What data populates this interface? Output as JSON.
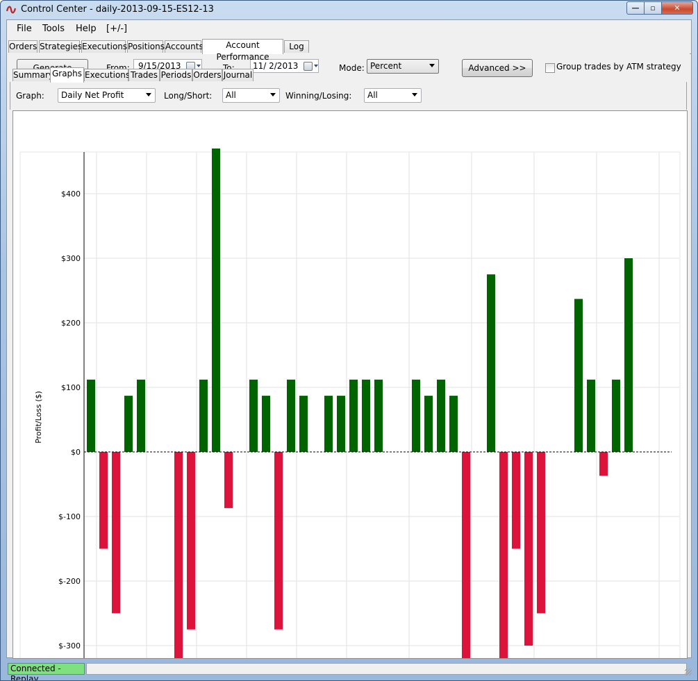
{
  "window": {
    "title": "Control Center - daily-2013-09-15-ES12-13",
    "min_glyph": "—",
    "max_glyph": "▫",
    "close_glyph": "✕"
  },
  "menu": {
    "file": "File",
    "tools": "Tools",
    "help": "Help",
    "toggle": "[+/-]"
  },
  "main_tabs": [
    "Orders",
    "Strategies",
    "Executions",
    "Positions",
    "Accounts",
    "Account Performance",
    "Log"
  ],
  "main_tab_active": "Account Performance",
  "toolbar": {
    "generate_label": "Generate",
    "from_label": "From:",
    "from_value": "9/15/2013",
    "to_label": "To:",
    "to_value": "11/ 2/2013",
    "mode_label": "Mode:",
    "mode_value": "Percent",
    "advanced_label": "Advanced >>",
    "group_label": "Group trades by ATM strategy",
    "group_checked": false
  },
  "sub_tabs": [
    "Summary",
    "Graphs",
    "Executions",
    "Trades",
    "Periods",
    "Orders",
    "Journal"
  ],
  "sub_tab_active": "Graphs",
  "filters": {
    "graph_label": "Graph:",
    "graph_value": "Daily Net Profit",
    "longshort_label": "Long/Short:",
    "longshort_value": "All",
    "winlose_label": "Winning/Losing:",
    "winlose_value": "All"
  },
  "chart_data": {
    "type": "bar",
    "ylabel": "Profit/Loss ($)",
    "xlabel": "",
    "title": "",
    "ylim": [
      -348,
      463
    ],
    "yticks": [
      400,
      300,
      200,
      100,
      0,
      -100,
      -200,
      -300
    ],
    "ytick_labels": [
      "$400",
      "$300",
      "$200",
      "$100",
      "$0",
      "$-100",
      "$-200",
      "$-300"
    ],
    "grid": true,
    "zero_line": "dashed",
    "colors": {
      "positive": "#006400",
      "negative": "#dc143c"
    },
    "values": [
      112,
      -150,
      -250,
      87,
      112,
      null,
      null,
      -350,
      -275,
      112,
      470,
      -87,
      null,
      112,
      87,
      -275,
      112,
      87,
      null,
      87,
      87,
      112,
      112,
      112,
      null,
      null,
      112,
      87,
      112,
      87,
      -325,
      null,
      275,
      -350,
      -150,
      -300,
      -250,
      null,
      null,
      237,
      112,
      -37,
      112,
      300
    ]
  },
  "status": {
    "connection": "Connected - Replay",
    "connection_color": "#7ee07e"
  }
}
